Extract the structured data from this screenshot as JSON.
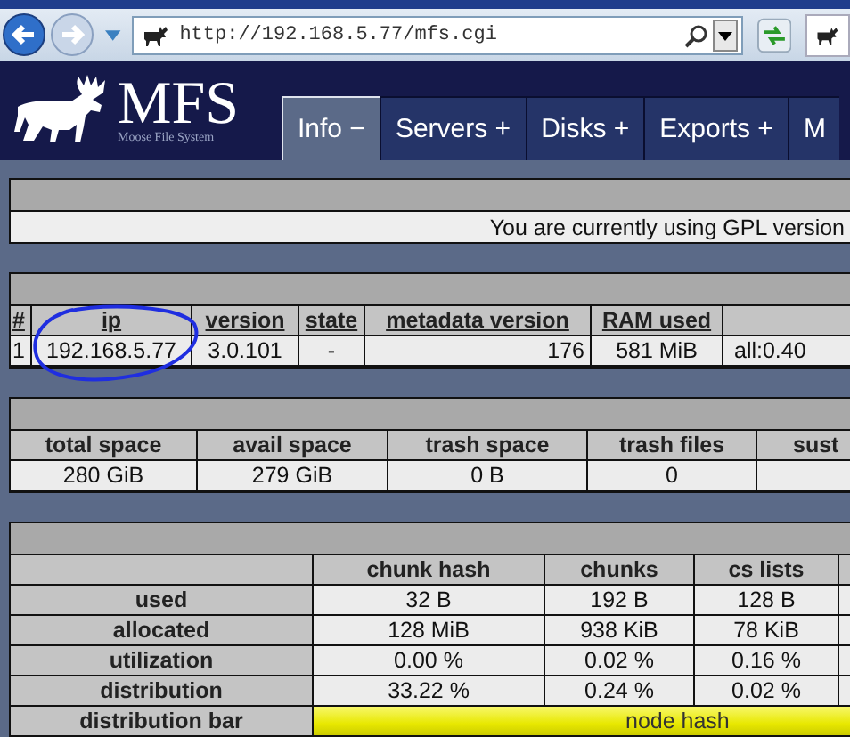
{
  "browser": {
    "address": "http://192.168.5.77/mfs.cgi"
  },
  "header": {
    "logo_text": "MFS",
    "logo_subtitle": "Moose File System",
    "tabs": [
      {
        "label": "Info −",
        "selected": true
      },
      {
        "label": "Servers +",
        "selected": false
      },
      {
        "label": "Disks +",
        "selected": false
      },
      {
        "label": "Exports +",
        "selected": false
      },
      {
        "label": "M",
        "selected": false
      }
    ]
  },
  "license_notice": "You are currently using GPL version",
  "masters": {
    "columns": [
      "#",
      "ip",
      "version",
      "state",
      "metadata version",
      "RAM used"
    ],
    "rows": [
      [
        "1",
        "192.168.5.77",
        "3.0.101",
        "-",
        "176",
        "581 MiB",
        "all:0.40"
      ]
    ]
  },
  "space": {
    "columns": [
      "total space",
      "avail space",
      "trash space",
      "trash files",
      "sust"
    ],
    "rows": [
      [
        "280 GiB",
        "279 GiB",
        "0 B",
        "0"
      ]
    ]
  },
  "memory": {
    "columns": [
      "chunk hash",
      "chunks",
      "cs lists"
    ],
    "rows": [
      {
        "label": "used",
        "values": [
          "32 B",
          "192 B",
          "128 B"
        ]
      },
      {
        "label": "allocated",
        "values": [
          "128 MiB",
          "938 KiB",
          "78 KiB"
        ]
      },
      {
        "label": "utilization",
        "values": [
          "0.00 %",
          "0.02 %",
          "0.16 %"
        ]
      },
      {
        "label": "distribution",
        "values": [
          "33.22 %",
          "0.24 %",
          "0.02 %"
        ]
      }
    ],
    "distribution_bar": {
      "label": "distribution bar",
      "text": "node hash"
    }
  }
}
